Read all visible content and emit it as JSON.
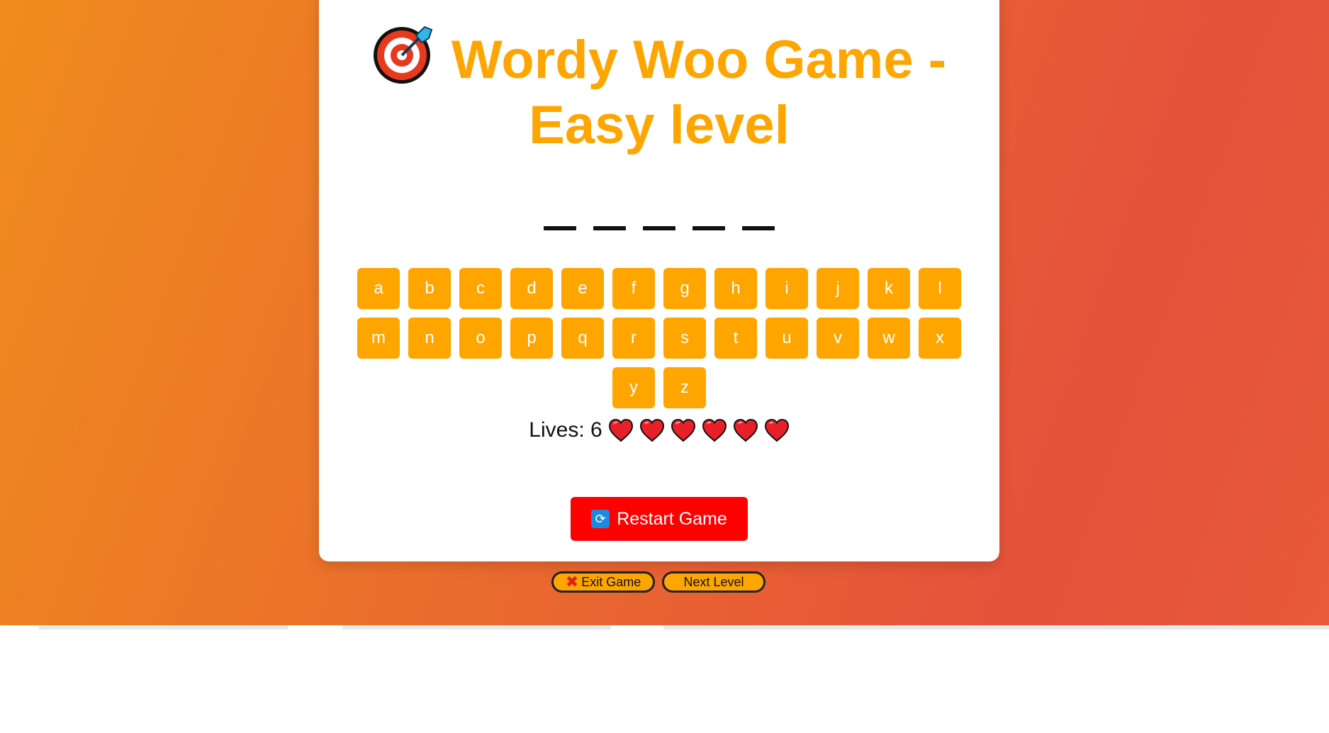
{
  "game": {
    "title_line1": "Wordy Woo Game -",
    "title_line2": "Easy level",
    "title_icon": "target-icon",
    "word_blanks": 5,
    "keyboard": [
      "a",
      "b",
      "c",
      "d",
      "e",
      "f",
      "g",
      "h",
      "i",
      "j",
      "k",
      "l",
      "m",
      "n",
      "o",
      "p",
      "q",
      "r",
      "s",
      "t",
      "u",
      "v",
      "w",
      "x",
      "y",
      "z"
    ],
    "lives_label": "Lives: 6",
    "lives_count": 6,
    "restart_label": "Restart Game",
    "exit_label": "Exit Game",
    "next_label": "Next Level"
  },
  "colors": {
    "accent": "#ffa500",
    "restart": "#ff0000",
    "bg_start": "#f08c1d",
    "bg_end": "#e5513b"
  }
}
